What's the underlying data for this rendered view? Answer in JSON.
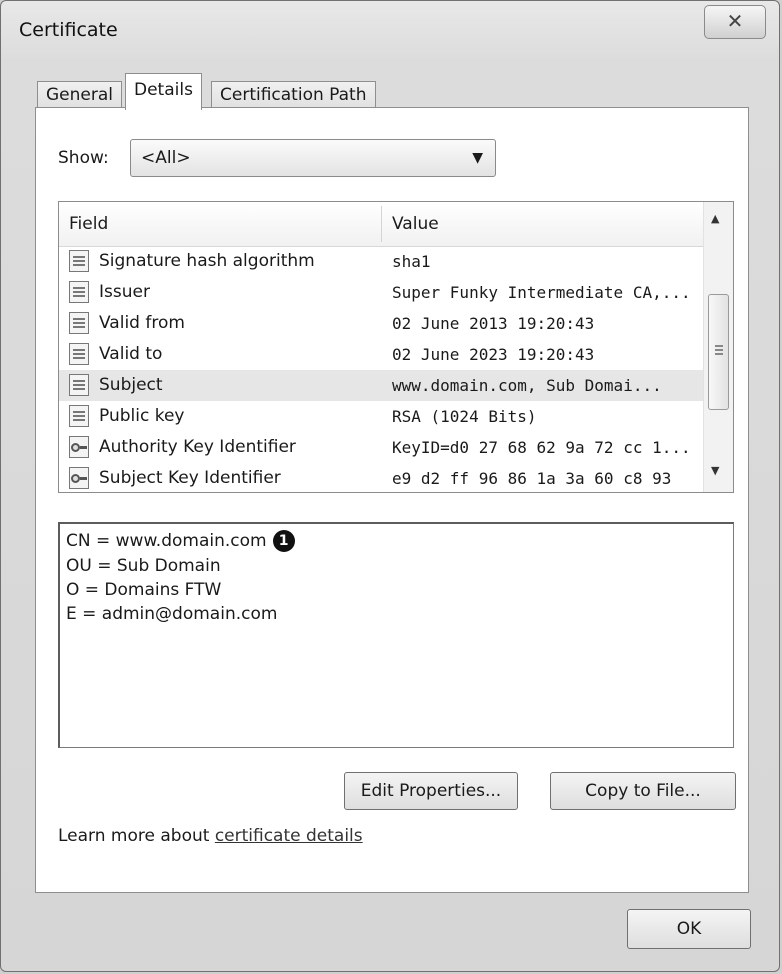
{
  "window": {
    "title": "Certificate",
    "close_glyph": "✕"
  },
  "tabs": [
    "General",
    "Details",
    "Certification Path"
  ],
  "active_tab": "Details",
  "show": {
    "label": "Show:",
    "value": "<All>",
    "arrow_icon": "▼"
  },
  "fields_list": {
    "columns": {
      "field": "Field",
      "value": "Value"
    },
    "rows": [
      {
        "field": "Signature hash algorithm",
        "value": "sha1",
        "icon": "certificate-field-icon"
      },
      {
        "field": "Issuer",
        "value": "Super Funky Intermediate CA,...",
        "icon": "certificate-field-icon"
      },
      {
        "field": "Valid from",
        "value": "02 June 2013 19:20:43",
        "icon": "certificate-field-icon"
      },
      {
        "field": "Valid to",
        "value": "02 June 2023 19:20:43",
        "icon": "certificate-field-icon"
      },
      {
        "field": "Subject",
        "value": "www.domain.com, Sub Domai...",
        "icon": "certificate-field-icon",
        "selected": true
      },
      {
        "field": "Public key",
        "value": "RSA (1024 Bits)",
        "icon": "certificate-field-icon"
      },
      {
        "field": "Authority Key Identifier",
        "value": "KeyID=d0 27 68 62 9a 72 cc 1...",
        "icon": "key-identifier-icon"
      },
      {
        "field": "Subject Key Identifier",
        "value": "e9 d2 ff 96 86 1a 3a 60 c8 93",
        "icon": "key-identifier-icon"
      }
    ],
    "scroll": {
      "up_icon": "▲",
      "down_icon": "▼"
    }
  },
  "details": {
    "lines": [
      "CN = www.domain.com",
      "OU = Sub Domain",
      "O = Domains FTW",
      "E = admin@domain.com"
    ],
    "callout": "1"
  },
  "buttons": {
    "edit_properties": "Edit Properties...",
    "copy_to_file": "Copy to File...",
    "ok": "OK"
  },
  "learn_more": {
    "text": "Learn more about ",
    "link": "certificate details"
  }
}
